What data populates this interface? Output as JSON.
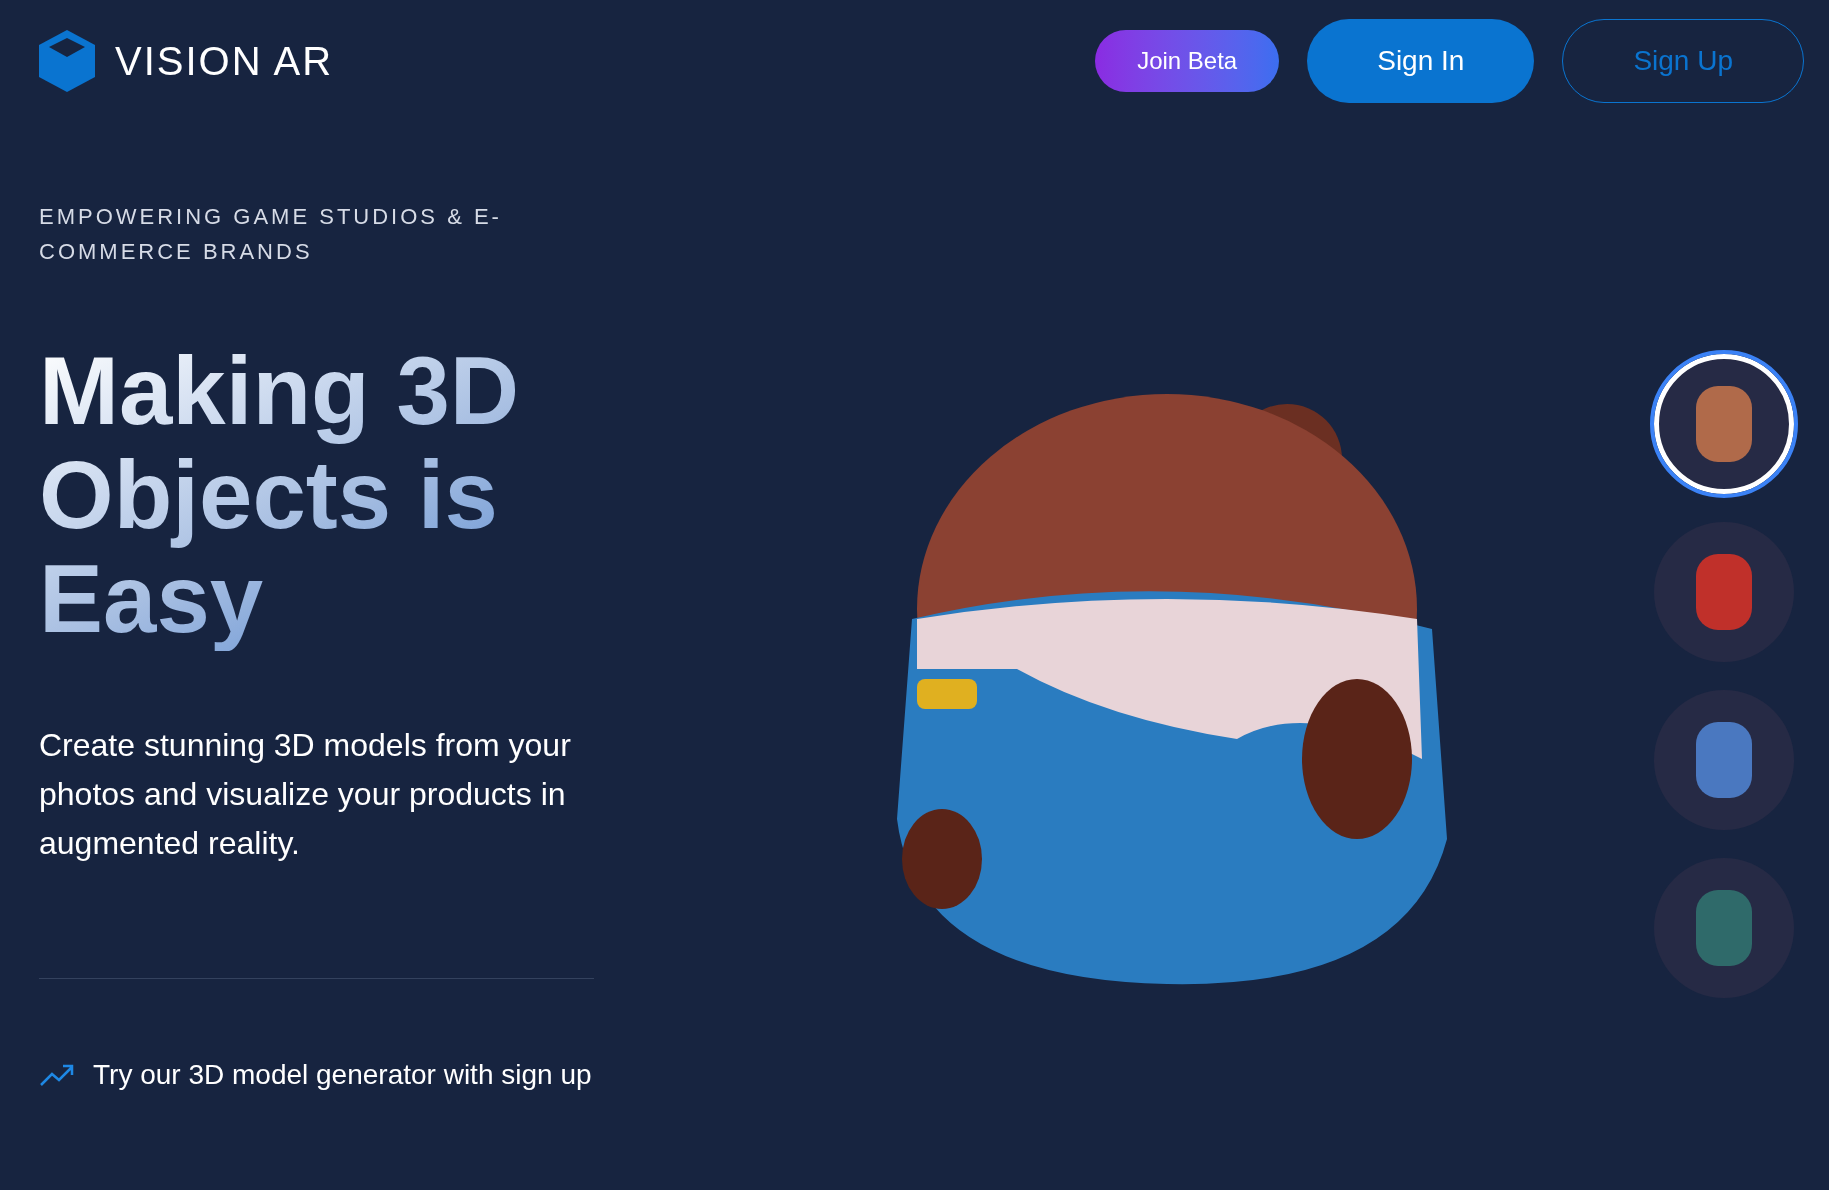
{
  "header": {
    "logo_text": "VISION AR",
    "buttons": [
      {
        "label": "Join Beta",
        "kind": "gradient"
      },
      {
        "label": "Sign In",
        "kind": "solid"
      },
      {
        "label": "Sign Up",
        "kind": "outline"
      }
    ]
  },
  "hero": {
    "eyebrow": "EMPOWERING GAME STUDIOS & E-COMMERCE BRANDS",
    "heading": "Making 3D Objects is Easy",
    "description": "Create stunning 3D models from your photos and visualize your products in augmented reality.",
    "cta": "Try our 3D model generator with sign up"
  },
  "models": [
    {
      "selected": true
    },
    {
      "selected": false
    },
    {
      "selected": false
    },
    {
      "selected": false
    }
  ]
}
